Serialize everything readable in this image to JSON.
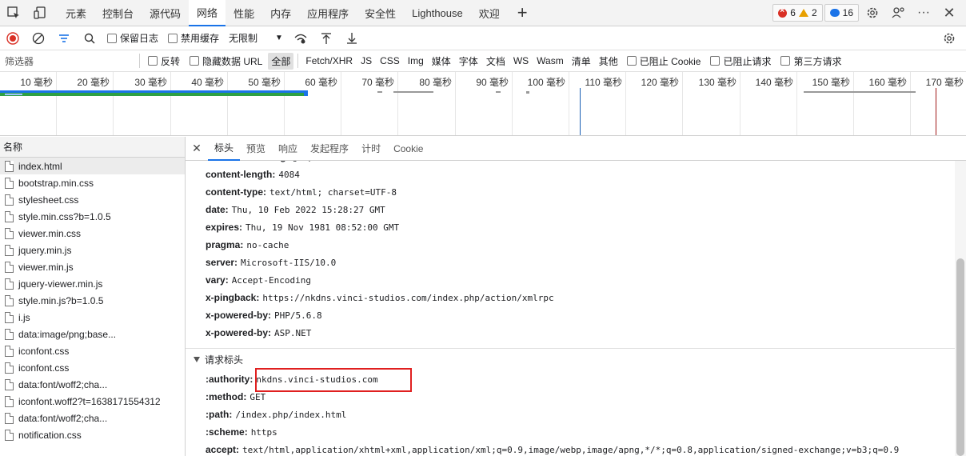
{
  "top_tabs": [
    "元素",
    "控制台",
    "源代码",
    "网络",
    "性能",
    "内存",
    "应用程序",
    "安全性",
    "Lighthouse",
    "欢迎"
  ],
  "active_tab": "网络",
  "badges": {
    "errors": "6",
    "warnings": "2",
    "messages": "16"
  },
  "toolbar": {
    "preserve_log": "保留日志",
    "disable_cache": "禁用缓存",
    "throttle": "无限制"
  },
  "filterbar": {
    "placeholder": "筛选器",
    "invert": "反转",
    "hide_data_urls": "隐藏数据 URL",
    "types": [
      "全部",
      "Fetch/XHR",
      "JS",
      "CSS",
      "Img",
      "媒体",
      "字体",
      "文档",
      "WS",
      "Wasm",
      "清单",
      "其他"
    ],
    "active_type": "全部",
    "blocked_cookies": "已阻止 Cookie",
    "blocked_requests": "已阻止请求",
    "third_party": "第三方请求"
  },
  "timeline": {
    "ticks": [
      "10 毫秒",
      "20 毫秒",
      "30 毫秒",
      "40 毫秒",
      "50 毫秒",
      "60 毫秒",
      "70 毫秒",
      "80 毫秒",
      "90 毫秒",
      "100 毫秒",
      "110 毫秒",
      "120 毫秒",
      "130 毫秒",
      "140 毫秒",
      "150 毫秒",
      "160 毫秒",
      "170 毫秒"
    ],
    "colors": {
      "dom_content_loaded": "#1a5fb4",
      "load": "#a01818",
      "bar_blue": "#1a73e8",
      "bar_green": "#2ea043"
    }
  },
  "file_list": {
    "header": "名称",
    "files": [
      "index.html",
      "bootstrap.min.css",
      "stylesheet.css",
      "style.min.css?b=1.0.5",
      "viewer.min.css",
      "jquery.min.js",
      "viewer.min.js",
      "jquery-viewer.min.js",
      "style.min.js?b=1.0.5",
      "i.js",
      "data:image/png;base...",
      "iconfont.css",
      "iconfont.css",
      "data:font/woff2;cha...",
      "iconfont.woff2?t=1638171554312",
      "data:font/woff2;cha...",
      "notification.css"
    ],
    "selected": "index.html"
  },
  "detail_tabs": [
    "标头",
    "预览",
    "响应",
    "发起程序",
    "计时",
    "Cookie"
  ],
  "active_detail_tab": "标头",
  "response_headers": [
    {
      "key": "content-encoding:",
      "value": "gzip"
    },
    {
      "key": "content-length:",
      "value": "4084"
    },
    {
      "key": "content-type:",
      "value": "text/html; charset=UTF-8"
    },
    {
      "key": "date:",
      "value": "Thu, 10 Feb 2022 15:28:27 GMT"
    },
    {
      "key": "expires:",
      "value": "Thu, 19 Nov 1981 08:52:00 GMT"
    },
    {
      "key": "pragma:",
      "value": "no-cache"
    },
    {
      "key": "server:",
      "value": "Microsoft-IIS/10.0"
    },
    {
      "key": "vary:",
      "value": "Accept-Encoding"
    },
    {
      "key": "x-pingback:",
      "value": "https://nkdns.vinci-studios.com/index.php/action/xmlrpc"
    },
    {
      "key": "x-powered-by:",
      "value": "PHP/5.6.8"
    },
    {
      "key": "x-powered-by:",
      "value": "ASP.NET"
    }
  ],
  "request_section_title": "请求标头",
  "request_headers": [
    {
      "key": ":authority:",
      "value": "nkdns.vinci-studios.com"
    },
    {
      "key": ":method:",
      "value": "GET"
    },
    {
      "key": ":path:",
      "value": "/index.php/index.html"
    },
    {
      "key": ":scheme:",
      "value": "https"
    },
    {
      "key": "accept:",
      "value": "text/html,application/xhtml+xml,application/xml;q=0.9,image/webp,image/apng,*/*;q=0.8,application/signed-exchange;v=b3;q=0.9"
    }
  ]
}
